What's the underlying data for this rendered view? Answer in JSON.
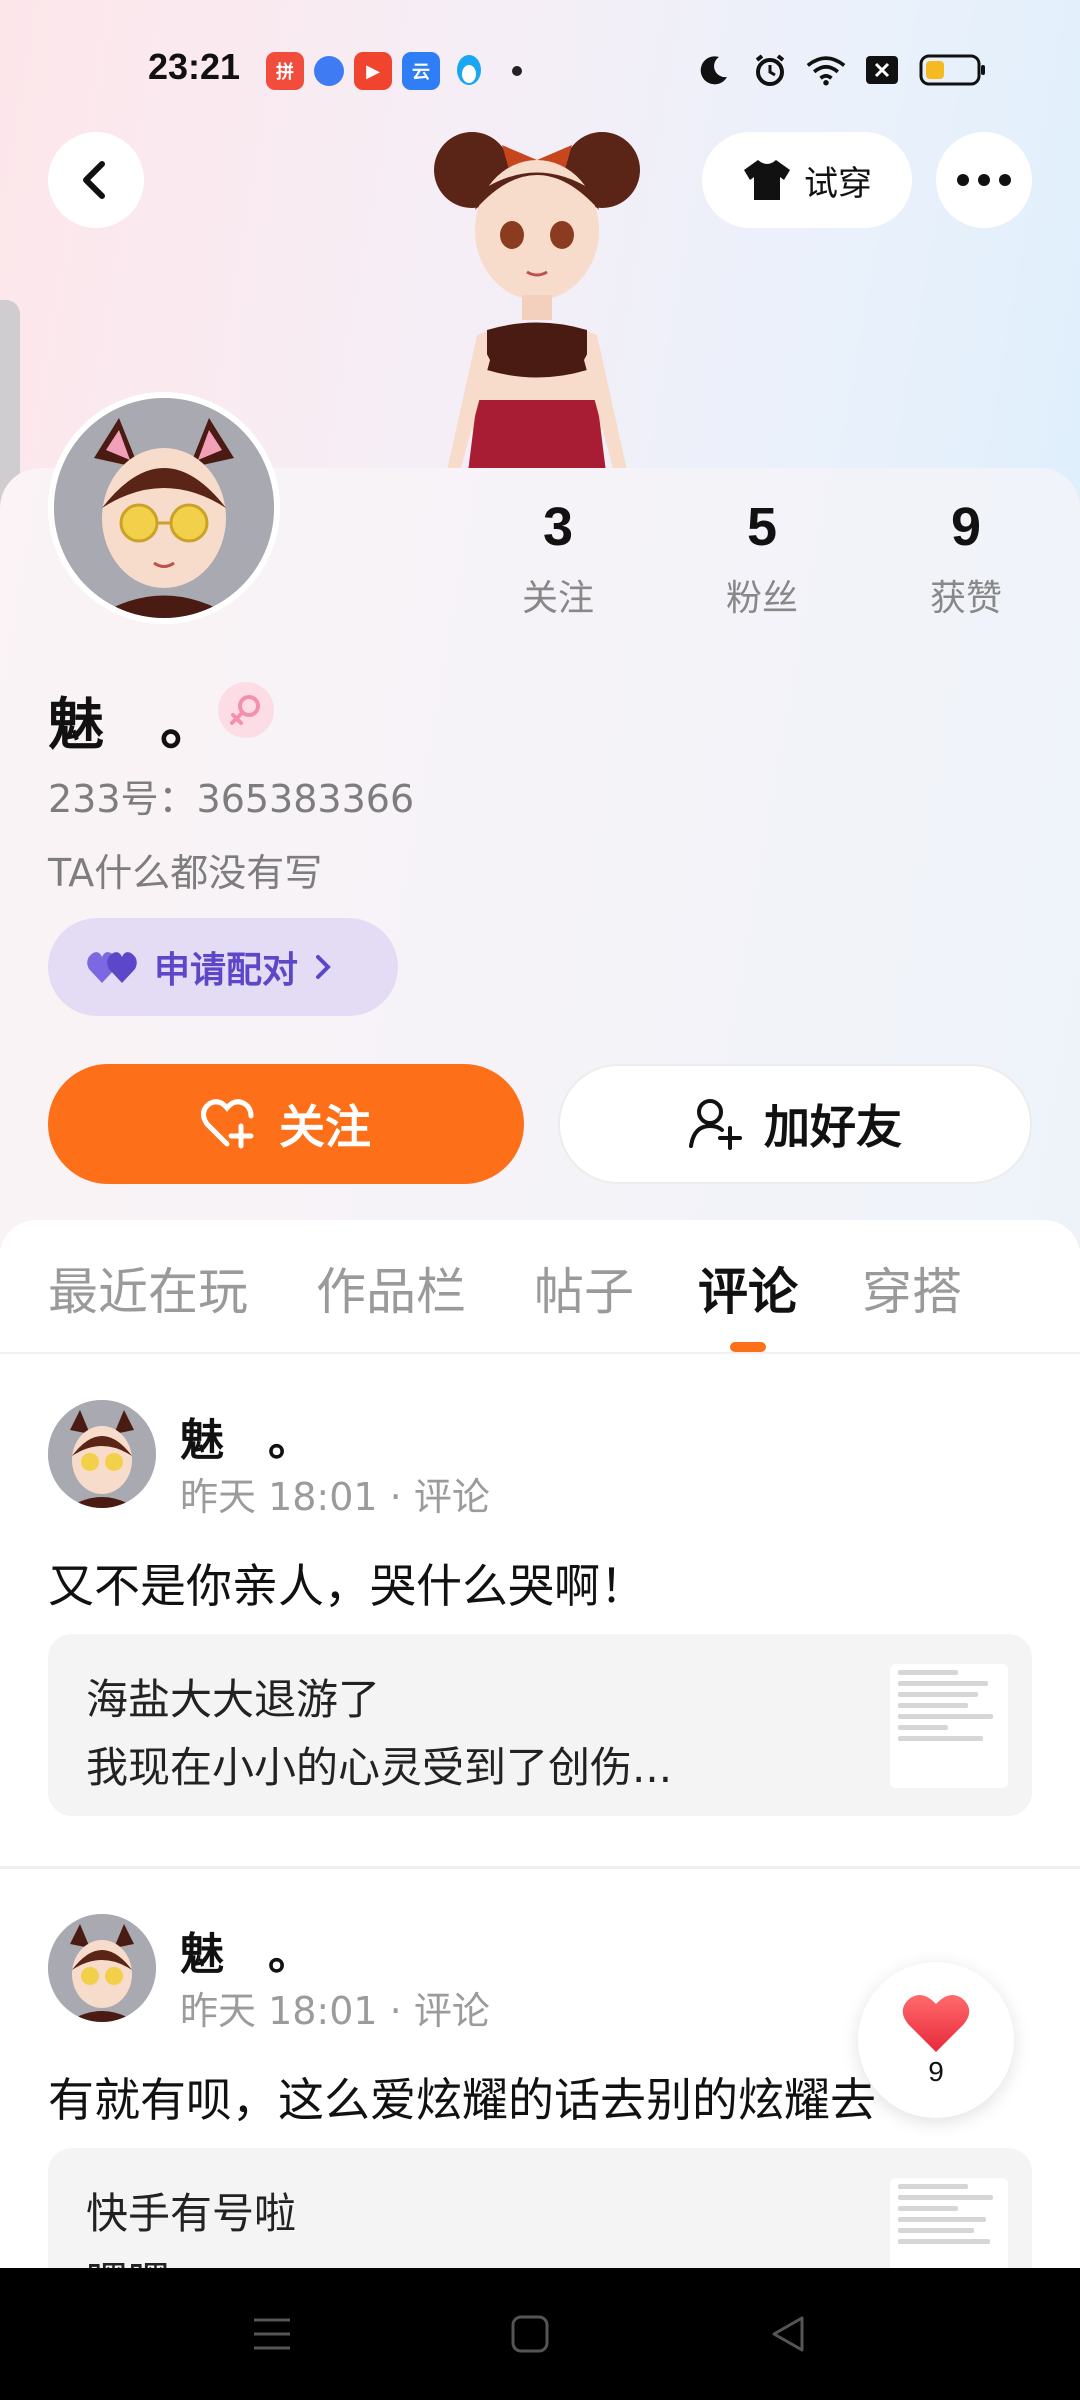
{
  "status_bar": {
    "time": "23:21",
    "apps": [
      {
        "name": "pinduoduo-icon",
        "color": "#f24c3d",
        "glyph": "拼"
      },
      {
        "name": "chat-bubble-icon",
        "color": "#3f7bf2",
        "glyph": "●"
      },
      {
        "name": "video-play-icon",
        "color": "#f0442e",
        "glyph": "▶"
      },
      {
        "name": "baidu-netdisk-icon",
        "color": "#2f7ef5",
        "glyph": "云"
      },
      {
        "name": "qq-penguin-icon",
        "color": "#19a7f2",
        "glyph": "Q"
      }
    ]
  },
  "header": {
    "tryon_label": "试穿"
  },
  "profile": {
    "following_value": "3",
    "following_label": "关注",
    "followers_value": "5",
    "followers_label": "粉丝",
    "likes_value": "9",
    "likes_label": "获赞",
    "name": "魅　。",
    "id_text": "233号：365383366",
    "bio": "TA什么都没有写",
    "pair_label": "申请配对",
    "follow_label": "关注",
    "add_friend_label": "加好友"
  },
  "tabs": [
    "最近在玩",
    "作品栏",
    "帖子",
    "评论",
    "穿搭"
  ],
  "active_tab": "评论",
  "comments": [
    {
      "author": "魅　。",
      "meta": "昨天 18:01 · 评论",
      "text": "又不是你亲人，哭什么哭啊！",
      "quote_line1": "海盐大大退游了",
      "quote_line2": "我现在小小的心灵受到了创伤..."
    },
    {
      "author": "魅　。",
      "meta": "昨天 18:01 · 评论",
      "text": "有就有呗，这么爱炫耀的话去别的炫耀去",
      "quote_line1": "快手有号啦",
      "quote_line2": "嘿嘿"
    }
  ],
  "floating_like": {
    "count": "9"
  },
  "colors": {
    "accent_orange": "#fd6f18",
    "pair_purple": "#5b47c8",
    "gender_pink": "#f48fb1"
  }
}
